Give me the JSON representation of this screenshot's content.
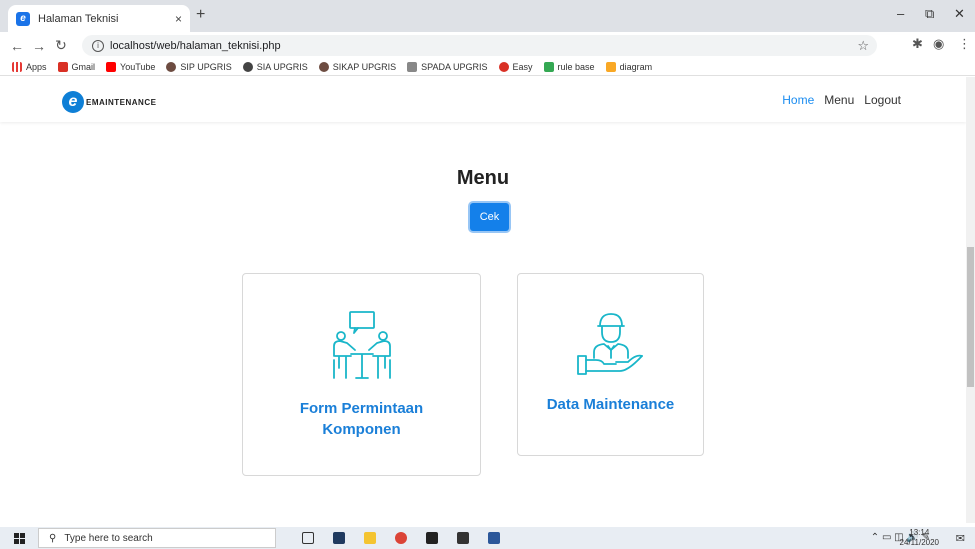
{
  "browser": {
    "tab_title": "Halaman Teknisi",
    "tab_close": "×",
    "new_tab": "+",
    "url": "localhost/web/halaman_teknisi.php",
    "bookmarks": [
      {
        "label": "Apps",
        "color": "#e53935"
      },
      {
        "label": "Gmail",
        "color": "#d93025"
      },
      {
        "label": "YouTube",
        "color": "#ff0000"
      },
      {
        "label": "SIP UPGRIS",
        "color": "#6d4c41"
      },
      {
        "label": "SIA UPGRIS",
        "color": "#444444"
      },
      {
        "label": "SIKAP UPGRIS",
        "color": "#6d4c41"
      },
      {
        "label": "SPADA UPGRIS",
        "color": "#888888"
      },
      {
        "label": "Easy",
        "color": "#d93025"
      },
      {
        "label": "rule base",
        "color": "#34a853"
      },
      {
        "label": "diagram",
        "color": "#f9a825"
      }
    ]
  },
  "navbar": {
    "logo_letter": "e",
    "logo_text": "EMAINTENANCE",
    "links": [
      "Home",
      "Menu",
      "Logout"
    ]
  },
  "main": {
    "title": "Menu",
    "cek_label": "Cek",
    "cards": [
      {
        "label": "Form Permintaan Komponen",
        "icon": "meeting-icon"
      },
      {
        "label": "Data Maintenance",
        "icon": "technician-icon"
      }
    ]
  },
  "taskbar": {
    "search_placeholder": "Type here to search",
    "time": "13:14",
    "date": "24/11/2020"
  },
  "colors": {
    "accent": "#1a7fd8",
    "button": "#1480ea",
    "icon": "#19b6c9"
  }
}
